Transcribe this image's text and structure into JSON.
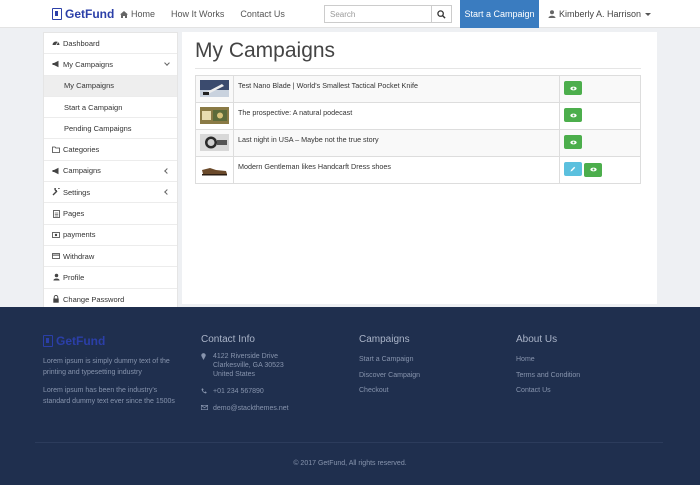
{
  "brand": {
    "name": "GetFund"
  },
  "nav": {
    "home": "Home",
    "how": "How It Works",
    "contact": "Contact Us"
  },
  "search": {
    "placeholder": "Search"
  },
  "cta": {
    "start_campaign": "Start a Campaign"
  },
  "user": {
    "name": "Kimberly A. Harrison"
  },
  "sidebar": {
    "dashboard": "Dashboard",
    "my_campaigns": "My Campaigns",
    "sub_my_campaigns": "My Campaigns",
    "sub_start": "Start a Campaign",
    "sub_pending": "Pending Campaigns",
    "categories": "Categories",
    "campaigns": "Campaigns",
    "settings": "Settings",
    "pages": "Pages",
    "payments": "payments",
    "withdraw": "Withdraw",
    "profile": "Profile",
    "change_password": "Change Password"
  },
  "main": {
    "title": "My Campaigns",
    "campaigns": [
      {
        "title": "Test Nano Blade | World's Smallest Tactical Pocket Knife"
      },
      {
        "title": "The prospective: A natural podecast"
      },
      {
        "title": "Last night in USA – Maybe not the true story"
      },
      {
        "title": "Modern Gentleman likes Handcarft Dress shoes"
      }
    ]
  },
  "footer": {
    "brand": "GetFund",
    "about_1": "Lorem ipsum is simply dummy text of the printing and typesetting industry",
    "about_2": "Lorem ipsum has been the industry's standard dummy text ever since the 1500s",
    "contact_title": "Contact Info",
    "address_1": "4122 Riverside Drive",
    "address_2": "Clarkesville, GA 30523",
    "address_3": "United States",
    "phone": "+01 234 567890",
    "email": "demo@stackthemes.net",
    "campaigns_title": "Campaigns",
    "camp_links": [
      "Start a Campaign",
      "Discover Campaign",
      "Checkout"
    ],
    "about_title": "About Us",
    "about_links": [
      "Home",
      "Terms and Condition",
      "Contact Us"
    ],
    "copyright": "© 2017 GetFund, All rights reserved."
  },
  "colors": {
    "primary": "#3a7cc0",
    "success": "#4cae4c",
    "info": "#5bc0de",
    "footer": "#1f2f4e"
  }
}
